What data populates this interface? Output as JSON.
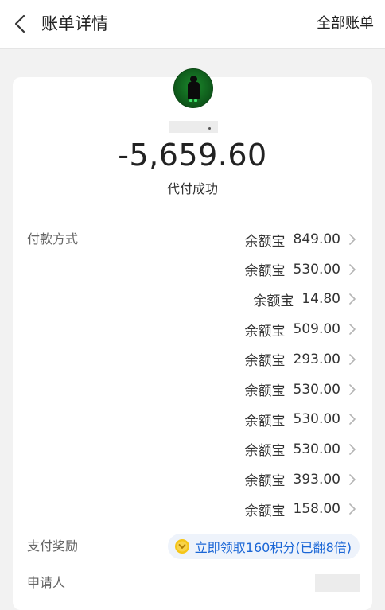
{
  "nav": {
    "title": "账单详情",
    "right_label": "全部账单"
  },
  "transaction": {
    "amount": "-5,659.60",
    "status": "代付成功"
  },
  "payment": {
    "label": "付款方式",
    "items": [
      {
        "method": "余额宝",
        "amount": "849.00"
      },
      {
        "method": "余额宝",
        "amount": "530.00"
      },
      {
        "method": "余额宝",
        "amount": "14.80"
      },
      {
        "method": "余额宝",
        "amount": "509.00"
      },
      {
        "method": "余额宝",
        "amount": "293.00"
      },
      {
        "method": "余额宝",
        "amount": "530.00"
      },
      {
        "method": "余额宝",
        "amount": "530.00"
      },
      {
        "method": "余额宝",
        "amount": "530.00"
      },
      {
        "method": "余额宝",
        "amount": "393.00"
      },
      {
        "method": "余额宝",
        "amount": "158.00"
      }
    ]
  },
  "reward": {
    "label": "支付奖励",
    "text": "立即领取160积分(已翻8倍)"
  },
  "applicant": {
    "label": "申请人"
  },
  "colors": {
    "accent": "#1a66d6",
    "coin": "#f5c518",
    "page_bg": "#f2f2f2"
  },
  "icons": {
    "back": "chevron-left-icon",
    "row_arrow": "chevron-right-icon",
    "reward": "coin-icon"
  }
}
